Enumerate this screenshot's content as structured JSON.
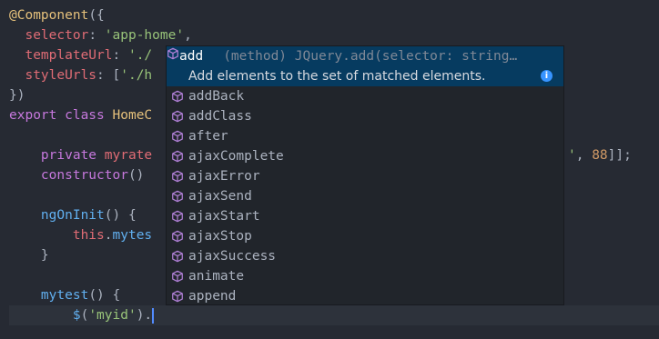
{
  "code": {
    "l1_decorator": "@Component",
    "l1_paren": "({",
    "l2_key": "  selector",
    "l2_colon": ": ",
    "l2_val": "'app-home'",
    "l2_comma": ",",
    "l3_key": "  templateUrl",
    "l3_colon": ": ",
    "l3_val": "'./",
    "l4_key": "  styleUrls",
    "l4_colon": ": [",
    "l4_val": "'./h",
    "l5": "})",
    "l6_export": "export",
    "l6_class": " class",
    "l6_name": " HomeC",
    "l8_private": "    private",
    "l8_name": " myrate",
    "l8_tail_q": "'",
    "l8_tail_comma": ", ",
    "l8_tail_num": "88",
    "l8_tail_end": "]];",
    "l9_ctor": "    constructor",
    "l9_paren": "()",
    "l11_fn": "    ngOnInit",
    "l11_paren": "() {",
    "l12_this": "        this",
    "l12_dot": ".",
    "l12_call": "mytes",
    "l13": "    }",
    "l15_fn": "    mytest",
    "l15_paren": "() {",
    "l16_dollar": "        $",
    "l16_paren1": "(",
    "l16_str": "'myid'",
    "l16_paren2": ").",
    "l16_dot": ""
  },
  "suggest": {
    "selected_label": "add",
    "selected_detail": "(method) JQuery.add(selector: string…",
    "selected_doc": "Add elements to the set of matched elements.",
    "info_glyph": "i",
    "items": [
      "addBack",
      "addClass",
      "after",
      "ajaxComplete",
      "ajaxError",
      "ajaxSend",
      "ajaxStart",
      "ajaxStop",
      "ajaxSuccess",
      "animate",
      "append"
    ],
    "icon": "method-cube-icon",
    "icon_color": "#b180d7",
    "accent": "#3794ff"
  }
}
